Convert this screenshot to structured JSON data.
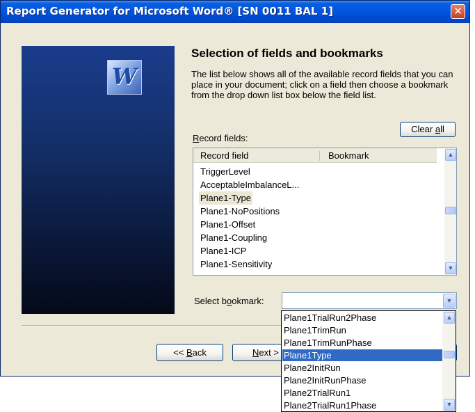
{
  "window": {
    "title": "Report Generator for Microsoft Word® [SN 0011 BAL 1]",
    "close_glyph": "✕"
  },
  "banner": {
    "logo_letter": "W",
    "logo_icon": "word-logo-icon"
  },
  "page": {
    "heading": "Selection of fields and bookmarks",
    "description": "The list below shows all of the available record fields that you can place in your document; click on a field then choose a bookmark from the drop down list box below the field list."
  },
  "clear_all": {
    "label_pre": "Clear ",
    "label_key": "a",
    "label_post": "ll"
  },
  "record_fields": {
    "label_key": "R",
    "label_rest": "ecord fields:",
    "columns": [
      "Record field",
      "Bookmark"
    ],
    "items": [
      "TriggerLevel",
      "AcceptableImbalanceL...",
      "Plane1-Type",
      "Plane1-NoPositions",
      "Plane1-Offset",
      "Plane1-Coupling",
      "Plane1-ICP",
      "Plane1-Sensitivity"
    ],
    "selected_index": 2,
    "scroll_up_glyph": "▲",
    "scroll_down_glyph": "▼"
  },
  "bookmark": {
    "label_pre": "Select b",
    "label_key": "o",
    "label_post": "okmark:",
    "value": "",
    "arrow_glyph": "▼",
    "options": [
      "Plane1TrialRun2Phase",
      "Plane1TrimRun",
      "Plane1TrimRunPhase",
      "Plane1Type",
      "Plane2InitRun",
      "Plane2InitRunPhase",
      "Plane2TrialRun1",
      "Plane2TrialRun1Phase"
    ],
    "selected_option_index": 3
  },
  "buttons": {
    "back_pre": "<< ",
    "back_key": "B",
    "back_post": "ack",
    "next_key": "N",
    "next_post": "ext >",
    "finish": ""
  }
}
